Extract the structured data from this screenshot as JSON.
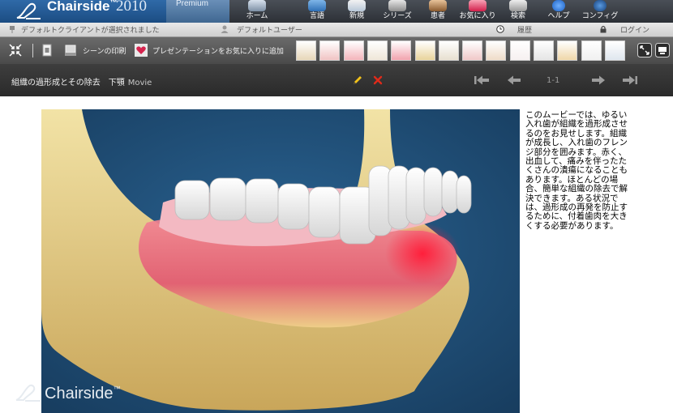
{
  "app": {
    "brand": "Chairside",
    "year": "2010",
    "edition": "Premium"
  },
  "nav": [
    {
      "label": "ホーム",
      "icon": "home-icon"
    },
    {
      "label": "言語",
      "icon": "language-icon"
    },
    {
      "label": "新規",
      "icon": "new-icon"
    },
    {
      "label": "シリーズ",
      "icon": "series-icon"
    },
    {
      "label": "患者",
      "icon": "patient-icon"
    },
    {
      "label": "お気に入り",
      "icon": "favorites-icon"
    },
    {
      "label": "検索",
      "icon": "search-icon"
    },
    {
      "label": "ヘルプ",
      "icon": "help-icon"
    },
    {
      "label": "コンフィグ",
      "icon": "config-icon"
    }
  ],
  "status": {
    "client": "デフォルトクライアントが選択されました",
    "user": "デフォルトユーザー",
    "history": "履歴",
    "login": "ログイン"
  },
  "toolbar": {
    "print_label": "シーンの印刷",
    "presentation_label": "プレゼンテーションをお気に入りに追加",
    "thumb_count": 14
  },
  "scene": {
    "title": "組織の過形成とその除去　下顎",
    "tag": "Movie",
    "page": "1-1"
  },
  "video": {
    "watermark": "Chairside",
    "watermark_mark": "™"
  },
  "description": "このムービーでは、ゆるい入れ歯が組織を過形成させるのをお見せします。組織が成長し、入れ歯のフレンジ部分を囲みます。赤く、出血して、痛みを伴ったたくさんの潰瘍になることもあります。ほとんどの場合、簡単な組織の除去で解決できます。ある状況では、過形成の再発を防止するために、付着歯肉を大きくする必要があります。",
  "colors": {
    "accent": "#1b4c82",
    "toolbar": "#555555",
    "video_bg": "#1f4f78",
    "gum": "#e85a6a",
    "bone": "#e8d48a"
  }
}
